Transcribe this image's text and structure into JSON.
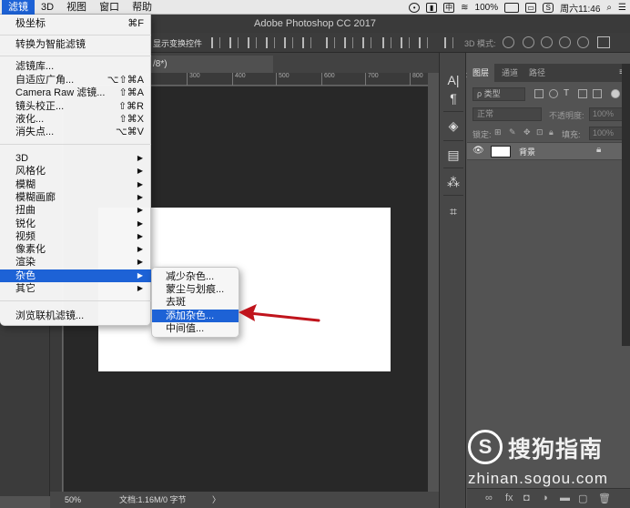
{
  "menubar": {
    "items": [
      {
        "label": "滤镜",
        "active": true
      },
      {
        "label": "3D"
      },
      {
        "label": "视图"
      },
      {
        "label": "窗口"
      },
      {
        "label": "帮助"
      }
    ],
    "status": {
      "battery": "100%",
      "clock": "周六11:46"
    }
  },
  "app": {
    "title": "Adobe Photoshop CC 2017",
    "options_label": "显示变换控件",
    "options_3d": "3D 模式:",
    "doc_tab": "/8*)"
  },
  "ruler": {
    "ticks": [
      "200",
      "300",
      "400",
      "500",
      "600",
      "700",
      "800",
      "900"
    ]
  },
  "status_bar": {
    "zoom": "50%",
    "doc_info": "文档:1.16M/0 字节",
    "arrow": "〉"
  },
  "layers_panel": {
    "tabs": [
      "图层",
      "通道",
      "路径"
    ],
    "filter_kind": "ρ 类型",
    "blend_mode": "正常",
    "opacity_label": "不透明度:",
    "opacity_value": "100%",
    "lock_label": "锁定:",
    "fill_label": "填充:",
    "fill_value": "100%",
    "layer_name": "背景",
    "footer_icons": [
      "∞",
      "fx",
      "◘",
      "◑",
      "▬",
      "▢",
      "🗑"
    ]
  },
  "filter_menu": {
    "items": [
      {
        "label": "极坐标",
        "shortcut": "⌘F"
      },
      {
        "label": "转换为智能滤镜"
      },
      {
        "label": "滤镜库..."
      },
      {
        "label": "自适应广角...",
        "shortcut": "⌥⇧⌘A"
      },
      {
        "label": "Camera Raw 滤镜...",
        "shortcut": "⇧⌘A"
      },
      {
        "label": "镜头校正...",
        "shortcut": "⇧⌘R"
      },
      {
        "label": "液化...",
        "shortcut": "⇧⌘X"
      },
      {
        "label": "消失点...",
        "shortcut": "⌥⌘V"
      },
      {
        "label": "3D",
        "submenu": true
      },
      {
        "label": "风格化",
        "submenu": true
      },
      {
        "label": "模糊",
        "submenu": true
      },
      {
        "label": "模糊画廊",
        "submenu": true
      },
      {
        "label": "扭曲",
        "submenu": true
      },
      {
        "label": "锐化",
        "submenu": true
      },
      {
        "label": "视频",
        "submenu": true
      },
      {
        "label": "像素化",
        "submenu": true
      },
      {
        "label": "渲染",
        "submenu": true
      },
      {
        "label": "杂色",
        "submenu": true,
        "selected": true
      },
      {
        "label": "其它",
        "submenu": true
      },
      {
        "label": "浏览联机滤镜..."
      }
    ],
    "arrow_glyph": "▶"
  },
  "noise_submenu": {
    "items": [
      {
        "label": "减少杂色..."
      },
      {
        "label": "蒙尘与划痕..."
      },
      {
        "label": "去斑"
      },
      {
        "label": "添加杂色...",
        "selected": true
      },
      {
        "label": "中间值..."
      }
    ]
  },
  "watermark": {
    "logo_letter": "S",
    "brand": "搜狗指南",
    "url": "zhinan.sogou.com"
  },
  "colors": {
    "menu_highlight": "#1d62d6",
    "annotation_arrow": "#c0141c",
    "canvas": "#ffffff"
  }
}
